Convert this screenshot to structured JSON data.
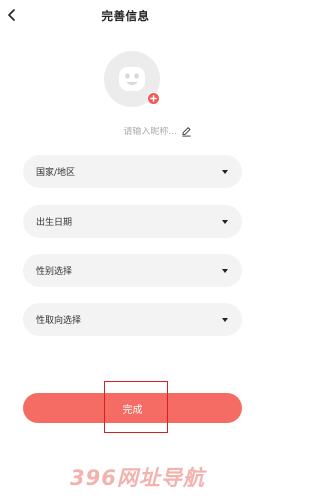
{
  "header": {
    "title": "完善信息",
    "back_icon": "chevron-left-icon"
  },
  "avatar": {
    "icon": "smiley-face-icon",
    "add_badge_icon": "plus-icon",
    "badge_color": "#f25a56"
  },
  "nickname": {
    "placeholder": "请输入昵称...",
    "value": "",
    "edit_icon": "pencil-icon"
  },
  "fields": [
    {
      "label": "国家/地区",
      "icon": "caret-down-icon"
    },
    {
      "label": "出生日期",
      "icon": "caret-down-icon"
    },
    {
      "label": "性别选择",
      "icon": "caret-down-icon"
    },
    {
      "label": "性取向选择",
      "icon": "caret-down-icon"
    }
  ],
  "submit": {
    "label": "完成",
    "color": "#f46c63"
  },
  "watermark": {
    "text": "396网址导航"
  }
}
